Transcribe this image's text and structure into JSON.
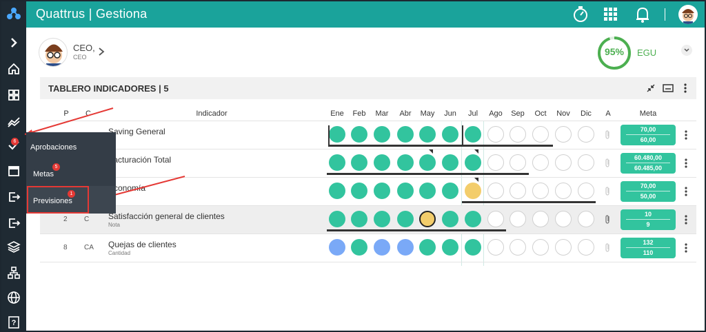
{
  "header": {
    "brand": "Quattrus | Gestiona"
  },
  "profile": {
    "name": "CEO,",
    "role": "CEO"
  },
  "egu": {
    "pct": "95%",
    "label": "EGU",
    "value": 0.95
  },
  "panel": {
    "title": "TABLERO INDICADORES | 5"
  },
  "menu": {
    "aprobaciones": "Aprobaciones",
    "metas": "Metas",
    "metas_badge": "5",
    "previsiones": "Previsiones",
    "previsiones_badge": "1",
    "nav_badge": "6"
  },
  "table": {
    "headers": {
      "p": "P",
      "c": "C",
      "ind": "Indicador",
      "a": "A",
      "meta": "Meta"
    },
    "months": [
      "Ene",
      "Feb",
      "Mar",
      "Abr",
      "May",
      "Jun",
      "Jul",
      "Ago",
      "Sep",
      "Oct",
      "Nov",
      "Dic"
    ],
    "rows": [
      {
        "p": "",
        "c": "",
        "name": "Saving General",
        "sub": "",
        "dots": [
          "g",
          "g",
          "g",
          "g",
          "g",
          "g",
          "g",
          "e",
          "e",
          "e",
          "e",
          "e"
        ],
        "meta": [
          "70,00",
          "60,00"
        ]
      },
      {
        "p": "",
        "c": "",
        "name": "Facturación Total",
        "sub": "",
        "dots": [
          "g",
          "g",
          "g",
          "g",
          "g",
          "g",
          "g",
          "e",
          "e",
          "e",
          "e",
          "e"
        ],
        "meta": [
          "60.480,00",
          "60.485,00"
        ]
      },
      {
        "p": "",
        "c": "",
        "name": "Economía",
        "sub": "",
        "dots": [
          "g",
          "g",
          "g",
          "g",
          "g",
          "g",
          "y",
          "e",
          "e",
          "e",
          "e",
          "e"
        ],
        "meta": [
          "70,00",
          "50,00"
        ]
      },
      {
        "p": "2",
        "c": "C",
        "name": "Satisfacción general de clientes",
        "sub": "Nota",
        "dots": [
          "g",
          "g",
          "g",
          "g",
          "yb",
          "g",
          "g",
          "e",
          "e",
          "e",
          "e",
          "e"
        ],
        "meta": [
          "10",
          "9"
        ]
      },
      {
        "p": "8",
        "c": "CA",
        "name": "Quejas de clientes",
        "sub": "Cantidad",
        "dots": [
          "b",
          "g",
          "b",
          "b",
          "g",
          "g",
          "g",
          "e",
          "e",
          "e",
          "e",
          "e"
        ],
        "meta": [
          "132",
          "110"
        ]
      }
    ]
  },
  "colors": {
    "green": "#32c49e",
    "yellow": "#f3cd6b",
    "blue": "#7aa9f7",
    "teal": "#1aa39b",
    "red": "#e53935"
  }
}
